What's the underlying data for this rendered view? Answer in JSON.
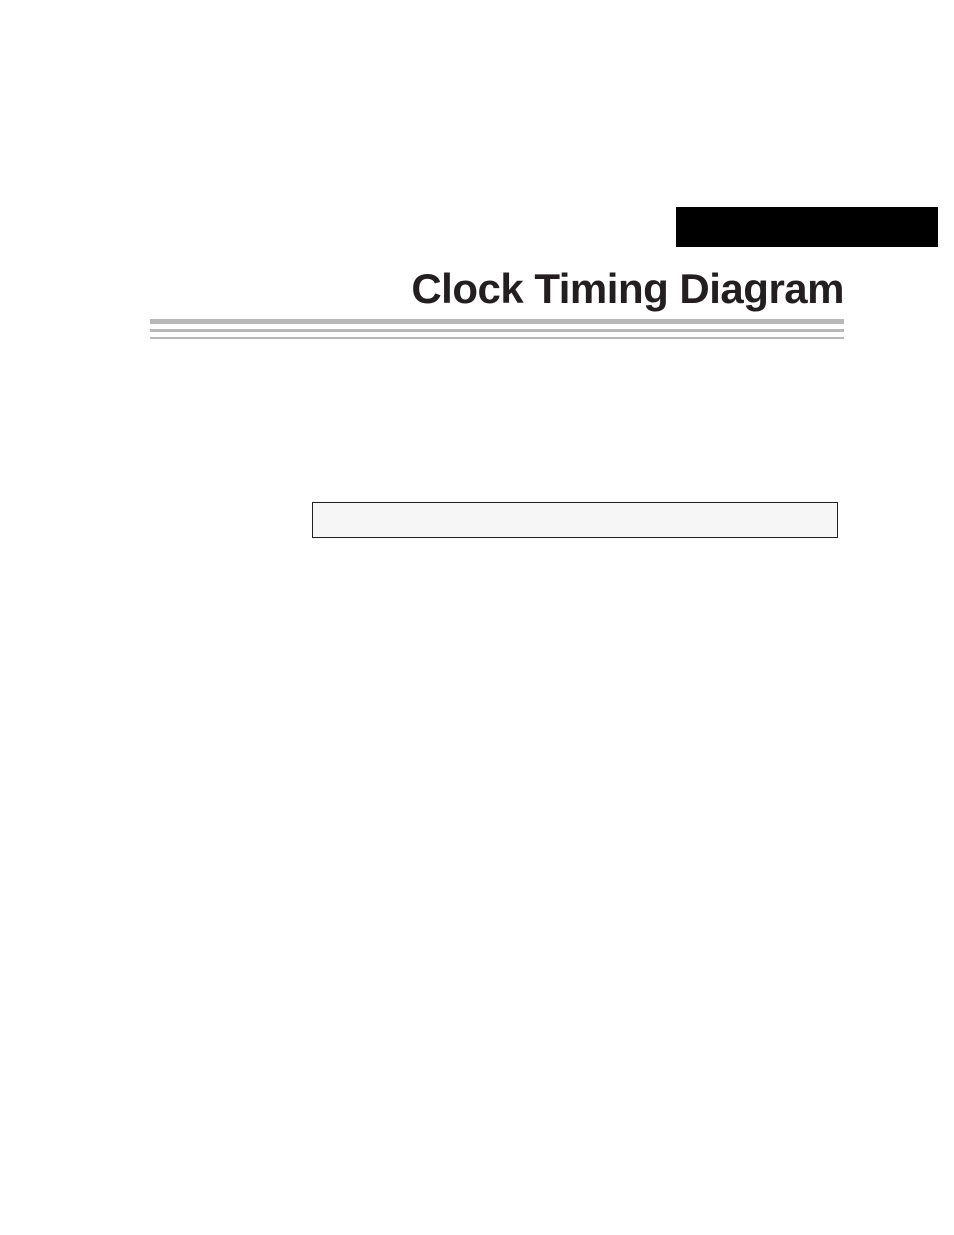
{
  "header": {
    "title": "Clock Timing Diagram"
  }
}
